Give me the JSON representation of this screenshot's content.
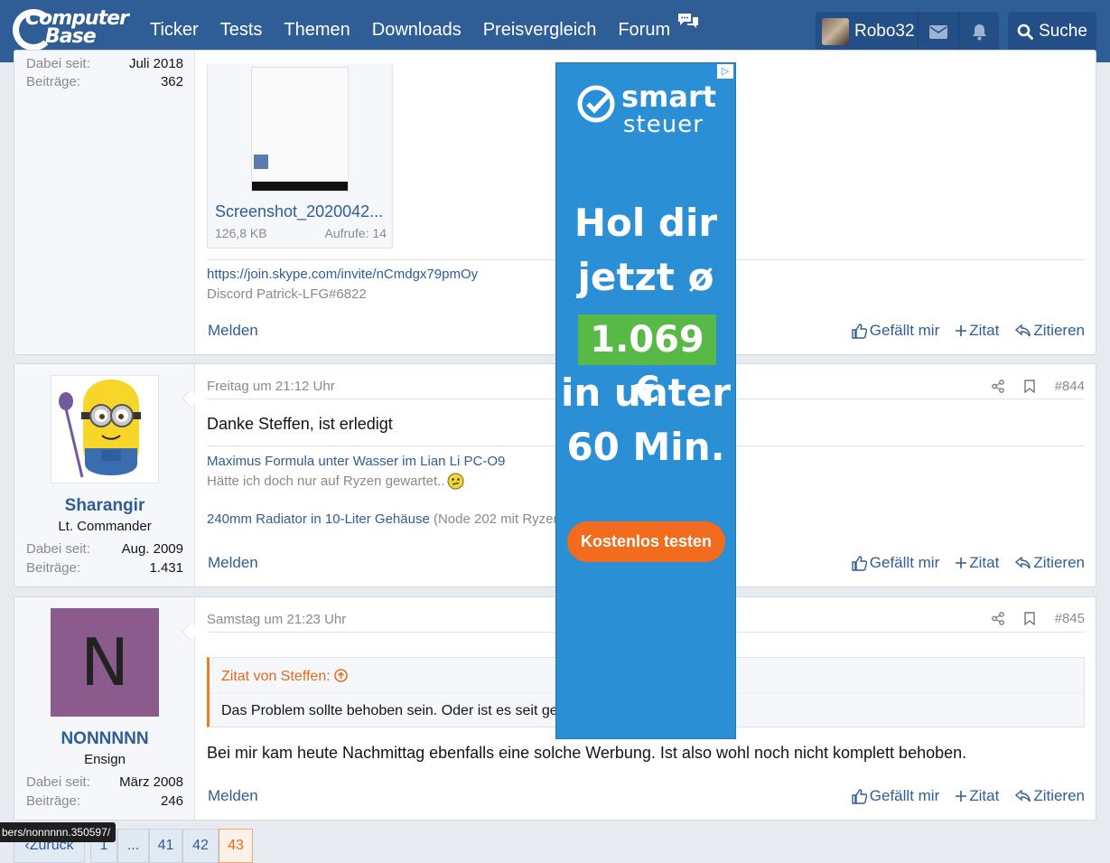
{
  "header": {
    "logo_line1": "Computer",
    "logo_line2": "Base",
    "nav": [
      "Ticker",
      "Tests",
      "Themen",
      "Downloads",
      "Preisvergleich",
      "Forum"
    ],
    "username": "Robo32",
    "search_label": "Suche"
  },
  "post1": {
    "joined_label": "Dabei seit:",
    "joined_value": "Juli 2018",
    "posts_label": "Beiträge:",
    "posts_value": "362",
    "attachment_name": "Screenshot_2020042...",
    "attachment_size": "126,8 KB",
    "attachment_views": "Aufrufe: 14",
    "sig_link": "https://join.skype.com/invite/nCmdgx79pmOy",
    "sig_text": "Discord Patrick-LFG#6822",
    "report": "Melden",
    "like": "Gefällt mir",
    "quote": "Zitat",
    "reply": "Zitieren"
  },
  "post2": {
    "username": "Sharangir",
    "rank": "Lt. Commander",
    "joined_label": "Dabei seit:",
    "joined_value": "Aug. 2009",
    "posts_label": "Beiträge:",
    "posts_value": "1.431",
    "date": "Freitag um 21:12 Uhr",
    "number": "#844",
    "content": "Danke Steffen, ist erledigt",
    "sig_link1": "Maximus Formula unter Wasser im Lian Li PC-O9",
    "sig_text1": "Hätte ich doch nur auf Ryzen gewartet..",
    "sig_link2": "240mm Radiator in 10-Liter Gehäuse",
    "sig_text2": "(Node 202 mit Ryzen",
    "report": "Melden",
    "like": "Gefällt mir",
    "quote": "Zitat",
    "reply": "Zitieren"
  },
  "post3": {
    "avatar_letter": "N",
    "avatar_color": "#8c5b8e",
    "username": "NONNNNN",
    "rank": "Ensign",
    "joined_label": "Dabei seit:",
    "joined_value": "März 2008",
    "posts_label": "Beiträge:",
    "posts_value": "246",
    "date": "Samstag um 21:23 Uhr",
    "number": "#845",
    "quote_header": "Zitat von Steffen:",
    "quote_text": "Das Problem sollte behoben sein. Oder ist es seit ge",
    "content": "Bei mir kam heute Nachmittag ebenfalls eine solche Werbung. Ist also wohl noch nicht komplett behoben.",
    "report": "Melden",
    "like": "Gefällt mir",
    "quote": "Zitat",
    "reply": "Zitieren"
  },
  "ad": {
    "brand1": "smart",
    "brand2": "steuer",
    "line1": "Hol dir",
    "line2": "jetzt ø",
    "price": "1.069 €",
    "line3": "in unter",
    "line4": "60 Min.",
    "cta": "Kostenlos testen",
    "color": "#2b8fd6"
  },
  "pagination": {
    "prev": "Zurück",
    "pages": [
      "1",
      "...",
      "41",
      "42",
      "43"
    ],
    "current": "43"
  },
  "status_tooltip": "bers/nonnnnn.350597/"
}
